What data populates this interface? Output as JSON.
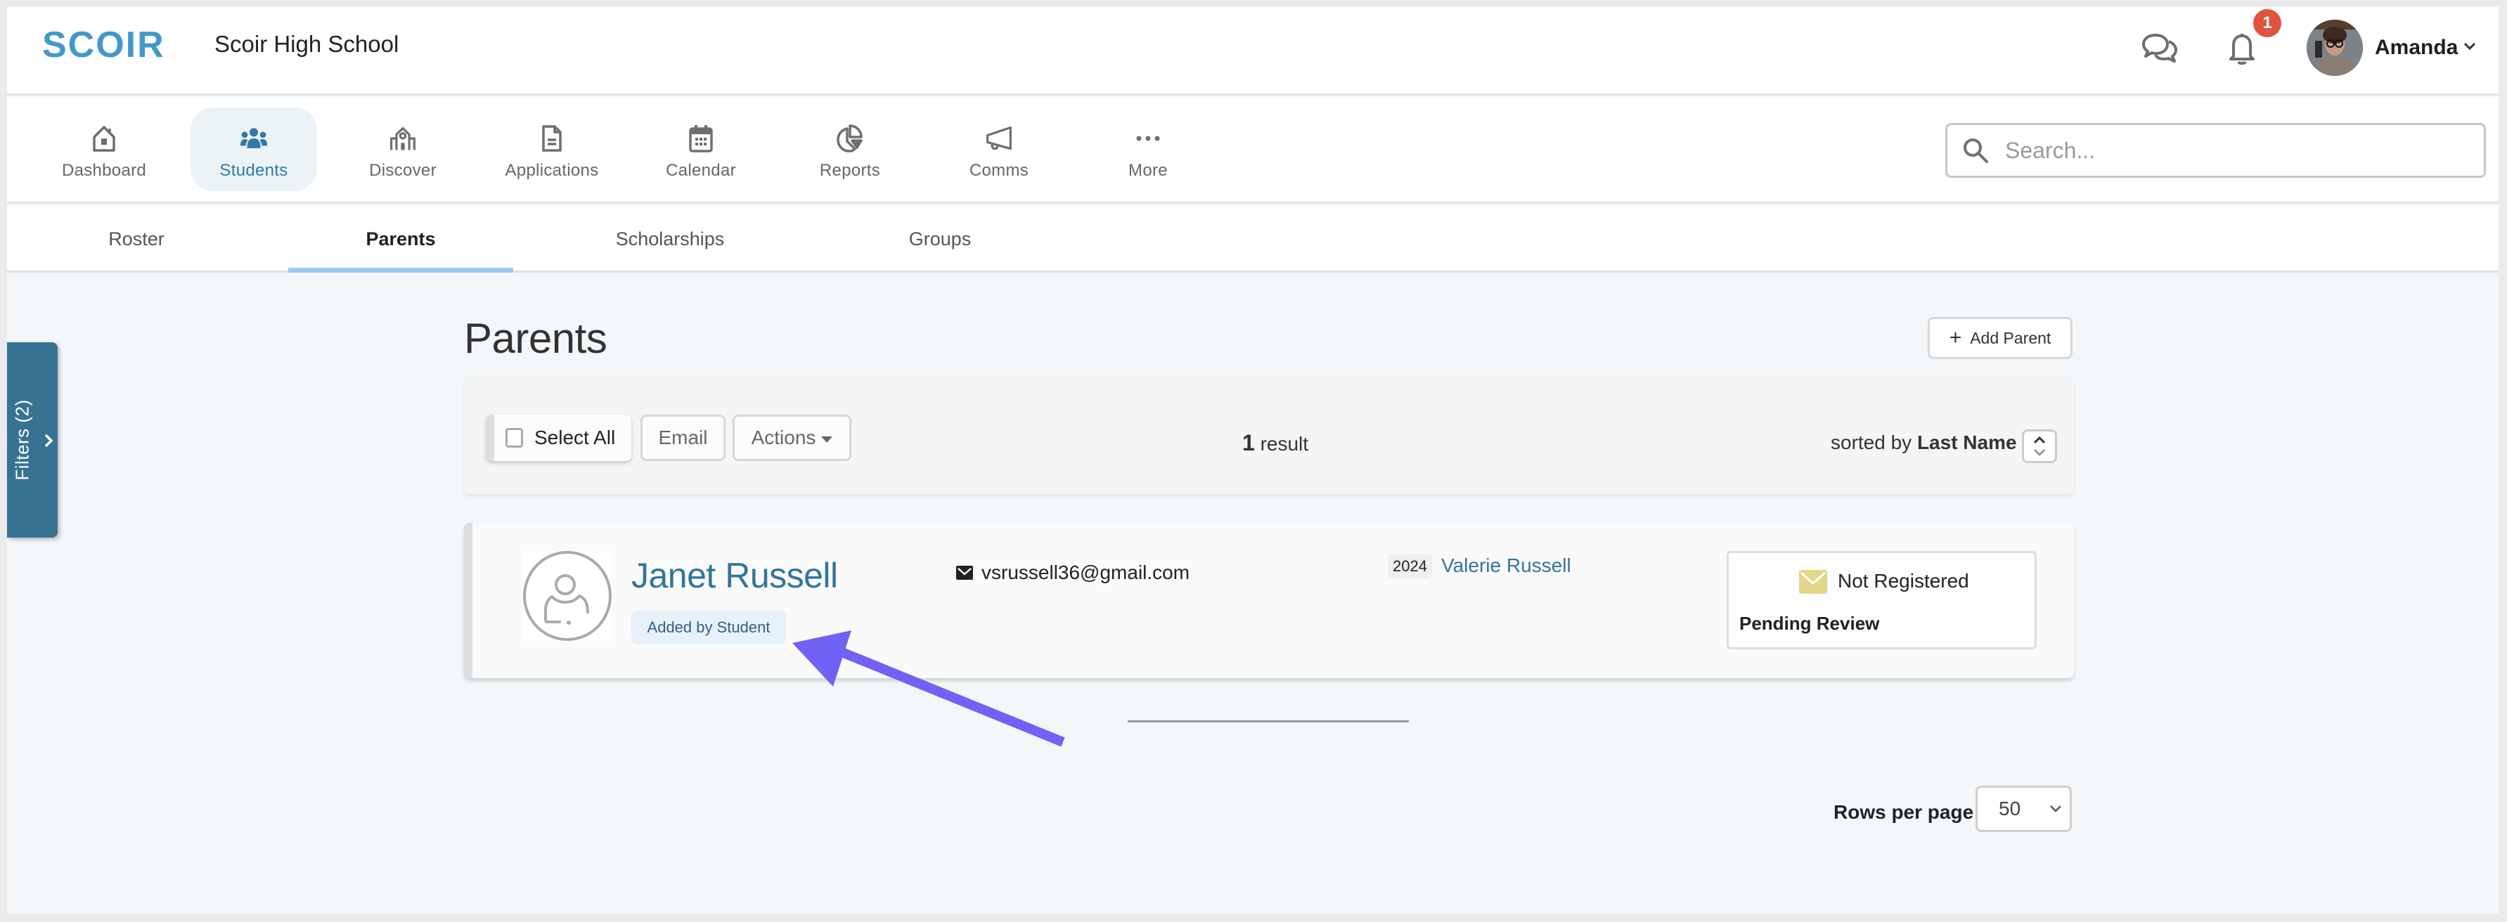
{
  "header": {
    "logo_text": "SCOIR",
    "school_name": "Scoir High School",
    "notification_count": "1",
    "user_name": "Amanda",
    "brand_color": "#4199ca",
    "badge_color": "#e0533f"
  },
  "nav": {
    "items": [
      {
        "label": "Dashboard",
        "icon": "home-icon"
      },
      {
        "label": "Students",
        "icon": "users-icon",
        "active": true
      },
      {
        "label": "Discover",
        "icon": "school-building-icon"
      },
      {
        "label": "Applications",
        "icon": "document-icon"
      },
      {
        "label": "Calendar",
        "icon": "calendar-icon"
      },
      {
        "label": "Reports",
        "icon": "pie-chart-icon"
      },
      {
        "label": "Comms",
        "icon": "megaphone-icon"
      },
      {
        "label": "More",
        "icon": "more-dots-icon"
      }
    ],
    "search_placeholder": "Search..."
  },
  "subtabs": {
    "items": [
      {
        "label": "Roster"
      },
      {
        "label": "Parents",
        "active": true
      },
      {
        "label": "Scholarships"
      },
      {
        "label": "Groups"
      }
    ]
  },
  "filters": {
    "label": "Filters (2)"
  },
  "main": {
    "title": "Parents",
    "add_button": "Add Parent",
    "toolbar": {
      "select_all": "Select All",
      "email": "Email",
      "actions": "Actions",
      "result_count": "1",
      "result_label": "result",
      "sorted_by_prefix": "sorted by",
      "sorted_by_field": "Last Name"
    },
    "parents": [
      {
        "name": "Janet Russell",
        "source_badge": "Added by Student",
        "email": "vsrussell36@gmail.com",
        "student_year": "2024",
        "student_name": "Valerie Russell",
        "registration_status": "Not Registered",
        "review_status": "Pending Review"
      }
    ],
    "pagination": {
      "rows_per_page_label": "Rows per page",
      "rows_per_page_value": "50"
    }
  },
  "annotation": {
    "arrow_color": "#7161f5"
  }
}
